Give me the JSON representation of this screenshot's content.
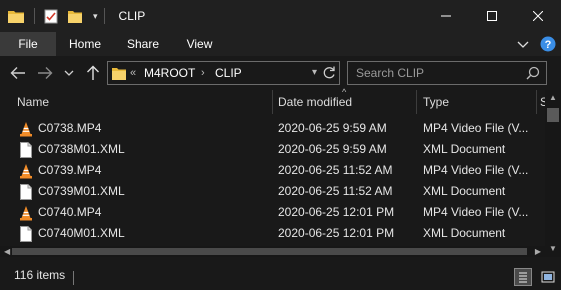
{
  "window": {
    "title": "CLIP"
  },
  "ribbon": {
    "tabs": [
      "File",
      "Home",
      "Share",
      "View"
    ]
  },
  "address": {
    "overflow": "«",
    "crumbs": [
      "M4ROOT",
      "CLIP"
    ]
  },
  "search": {
    "placeholder": "Search CLIP"
  },
  "columns": {
    "name": "Name",
    "date": "Date modified",
    "type": "Type",
    "size": "S"
  },
  "files": [
    {
      "name": "C0738.MP4",
      "date": "2020-06-25 9:59 AM",
      "type": "MP4 Video File (V...",
      "icon": "vlc-cone-icon"
    },
    {
      "name": "C0738M01.XML",
      "date": "2020-06-25 9:59 AM",
      "type": "XML Document",
      "icon": "document-icon"
    },
    {
      "name": "C0739.MP4",
      "date": "2020-06-25 11:52 AM",
      "type": "MP4 Video File (V...",
      "icon": "vlc-cone-icon"
    },
    {
      "name": "C0739M01.XML",
      "date": "2020-06-25 11:52 AM",
      "type": "XML Document",
      "icon": "document-icon"
    },
    {
      "name": "C0740.MP4",
      "date": "2020-06-25 12:01 PM",
      "type": "MP4 Video File (V...",
      "icon": "vlc-cone-icon"
    },
    {
      "name": "C0740M01.XML",
      "date": "2020-06-25 12:01 PM",
      "type": "XML Document",
      "icon": "document-icon"
    }
  ],
  "status": {
    "item_count": "116 items"
  },
  "colors": {
    "background": "#191919",
    "titlebar": "#202020",
    "folder": "#f2c94c",
    "vlc_orange": "#f28c28",
    "help": "#3a8ee6"
  }
}
